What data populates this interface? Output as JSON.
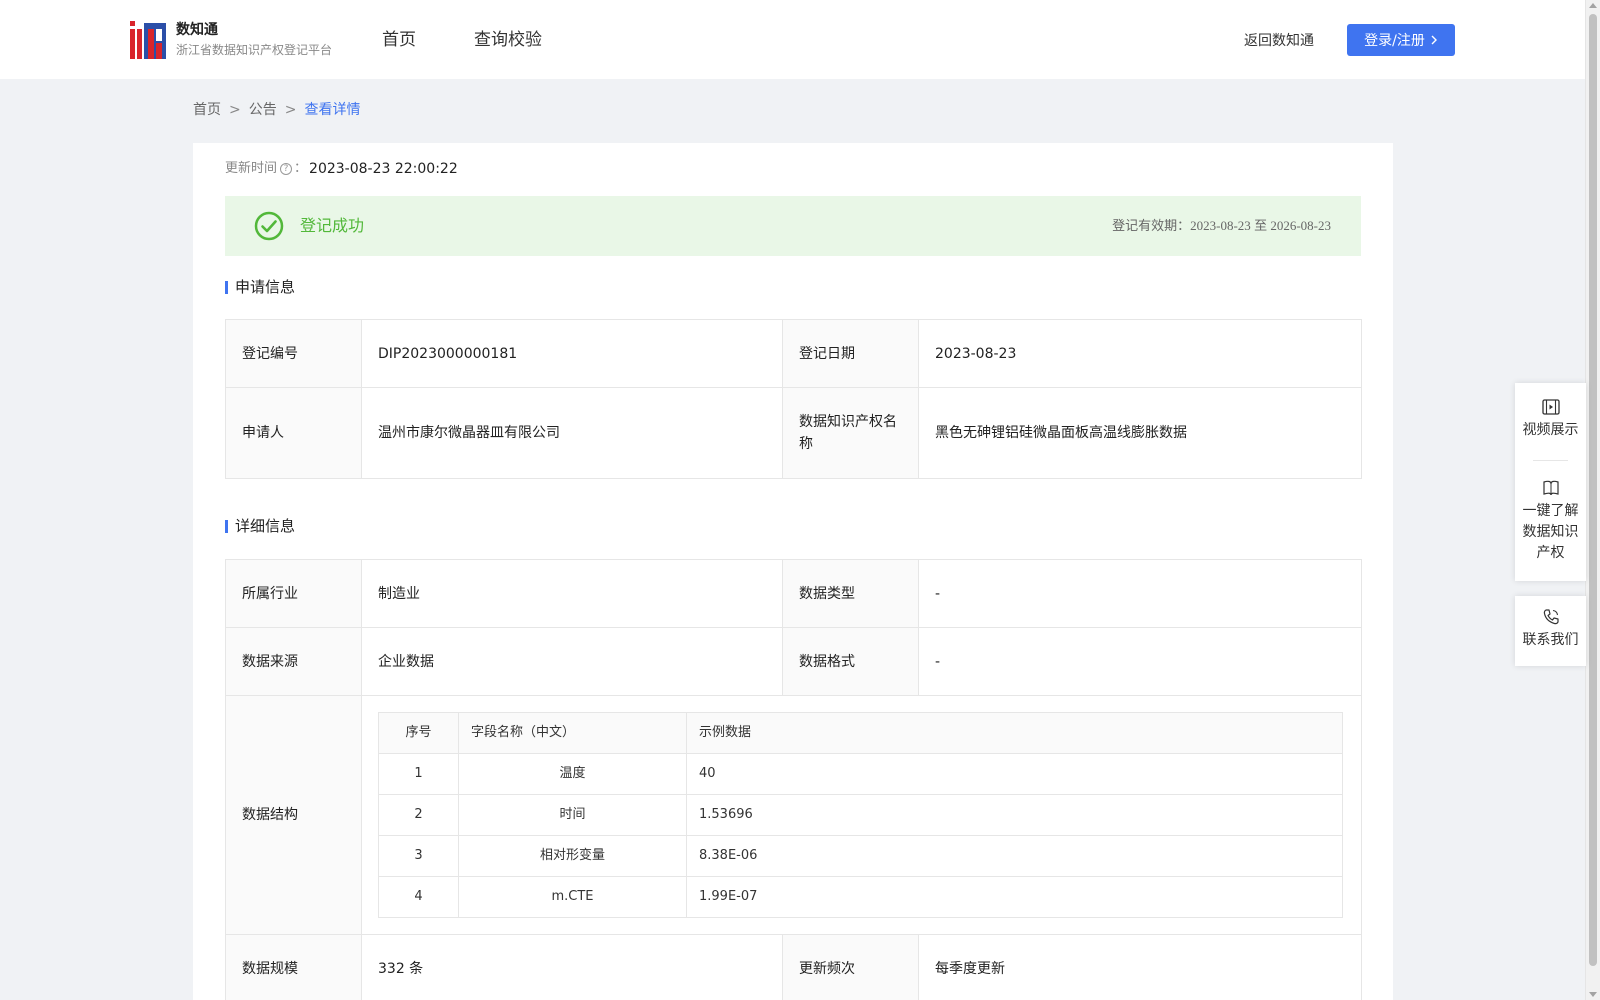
{
  "header": {
    "brand_name": "数知通",
    "brand_subtitle": "浙江省数据知识产权登记平台",
    "nav": [
      "首页",
      "查询校验"
    ],
    "back_link": "返回数知通",
    "login_button": "登录/注册"
  },
  "breadcrumb": {
    "items": [
      "首页",
      "公告"
    ],
    "separator": ">",
    "current": "查看详情"
  },
  "update": {
    "label": "更新时间",
    "colon": "：",
    "value": "2023-08-23 22:00:22"
  },
  "status": {
    "text": "登记成功",
    "validity_label": "登记有效期：",
    "validity_start": "2023-08-23",
    "validity_to": "至",
    "validity_end": "2026-08-23",
    "color": "#52b83a"
  },
  "application": {
    "title": "申请信息",
    "reg_no_label": "登记编号",
    "reg_no": "DIP2023000000181",
    "reg_date_label": "登记日期",
    "reg_date": "2023-08-23",
    "applicant_label": "申请人",
    "applicant": "温州市康尔微晶器皿有限公司",
    "ip_name_label": "数据知识产权名称",
    "ip_name": "黑色无砷锂铝硅微晶面板高温线膨胀数据"
  },
  "details": {
    "title": "详细信息",
    "industry_label": "所属行业",
    "industry": "制造业",
    "data_type_label": "数据类型",
    "data_type": "-",
    "source_label": "数据来源",
    "source": "企业数据",
    "format_label": "数据格式",
    "format": "-",
    "structure_label": "数据结构",
    "structure_headers": [
      "序号",
      "字段名称（中文）",
      "示例数据"
    ],
    "structure_rows": [
      {
        "no": "1",
        "field": "温度",
        "example": "40"
      },
      {
        "no": "2",
        "field": "时间",
        "example": "1.53696"
      },
      {
        "no": "3",
        "field": "相对形变量",
        "example": "8.38E-06"
      },
      {
        "no": "4",
        "field": "m.CTE",
        "example": "1.99E-07"
      }
    ],
    "scale_label": "数据规模",
    "scale": "332 条",
    "frequency_label": "更新频次",
    "frequency": "每季度更新"
  },
  "sidebar": {
    "video": "视频展示",
    "learn_line1": "一键了解",
    "learn_line2": "数据知识",
    "learn_line3": "产权",
    "contact": "联系我们"
  },
  "colors": {
    "accent": "#3f74f0",
    "success": "#52b83a",
    "logo_red": "#d9252b",
    "logo_blue": "#2b4fa8"
  }
}
